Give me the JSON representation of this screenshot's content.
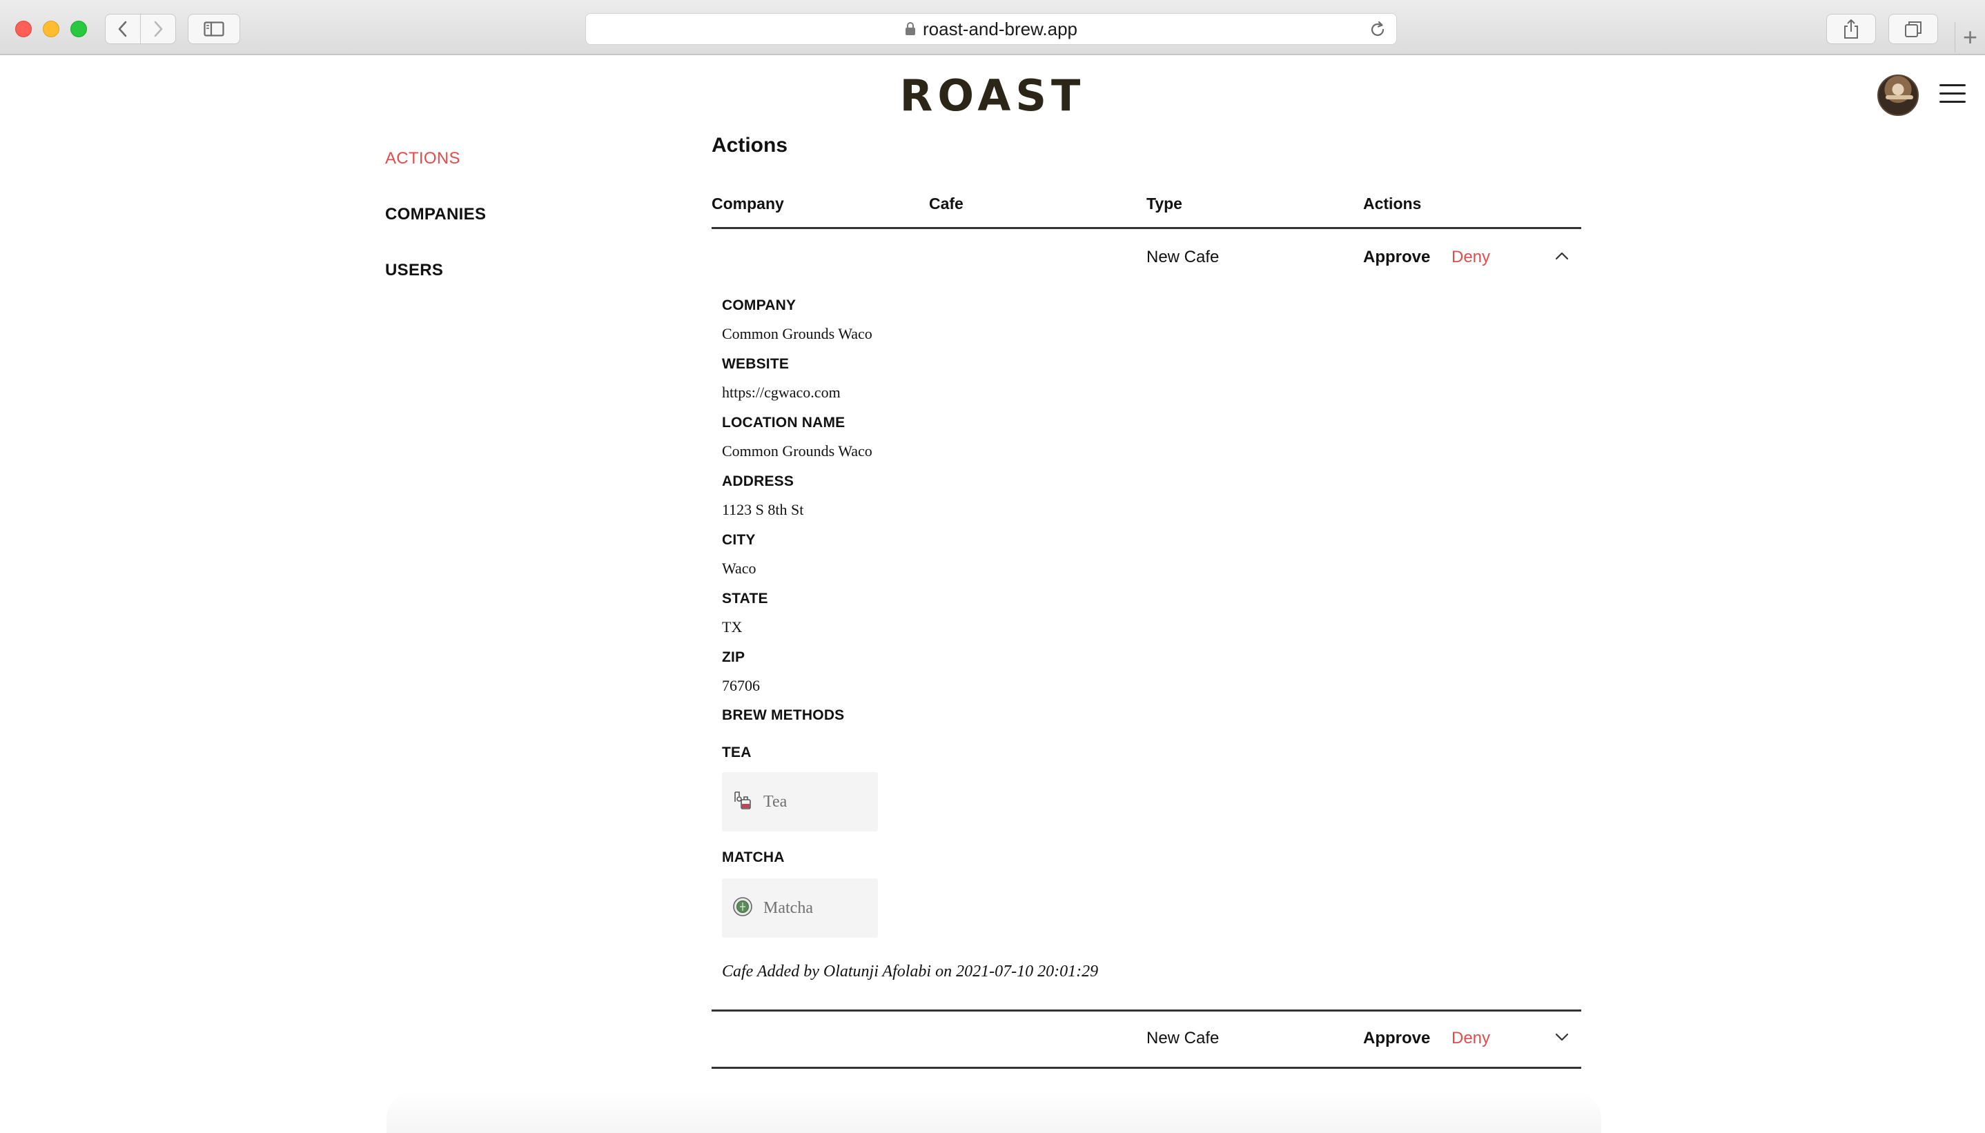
{
  "browser": {
    "url": "roast-and-brew.app",
    "new_tab": "+"
  },
  "header": {
    "logo": "ROAST"
  },
  "nav": {
    "items": [
      {
        "label": "ACTIONS",
        "active": true
      },
      {
        "label": "COMPANIES",
        "active": false
      },
      {
        "label": "USERS",
        "active": false
      }
    ]
  },
  "main": {
    "title": "Actions",
    "columns": [
      "Company",
      "Cafe",
      "Type",
      "Actions"
    ],
    "rows": [
      {
        "company": "",
        "cafe": "",
        "type": "New Cafe",
        "approve": "Approve",
        "deny": "Deny",
        "expanded": true
      },
      {
        "company": "",
        "cafe": "",
        "type": "New Cafe",
        "approve": "Approve",
        "deny": "Deny",
        "expanded": false
      }
    ],
    "details": {
      "fields": [
        {
          "label": "COMPANY",
          "value": "Common Grounds Waco"
        },
        {
          "label": "WEBSITE",
          "value": "https://cgwaco.com"
        },
        {
          "label": "LOCATION NAME",
          "value": "Common Grounds Waco"
        },
        {
          "label": "ADDRESS",
          "value": "1123 S 8th St"
        },
        {
          "label": "CITY",
          "value": "Waco"
        },
        {
          "label": "STATE",
          "value": "TX"
        },
        {
          "label": "ZIP",
          "value": "76706"
        }
      ],
      "brew_methods_label": "BREW METHODS",
      "brew_methods": [
        {
          "heading": "TEA",
          "label": "Tea",
          "icon": "teapot-icon"
        },
        {
          "heading": "MATCHA",
          "label": "Matcha",
          "icon": "matcha-icon"
        }
      ],
      "footnote": "Cafe Added by Olatunji Afolabi on 2021-07-10 20:01:29"
    }
  },
  "colors": {
    "accent": "#e24c4b",
    "logo": "#2b2618",
    "card_bg": "#f4f4f4"
  }
}
